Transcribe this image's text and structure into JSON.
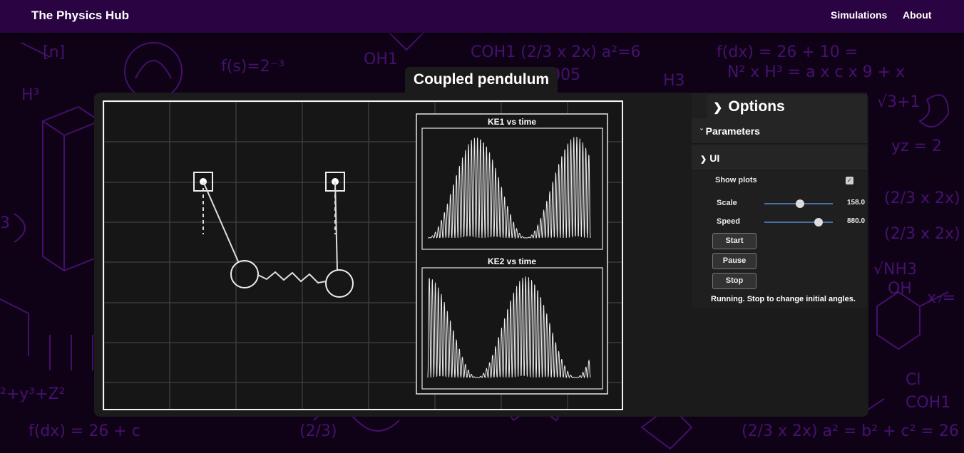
{
  "nav": {
    "brand": "The Physics Hub",
    "links": [
      "Simulations",
      "About"
    ]
  },
  "simulation": {
    "title": "Coupled pendulum",
    "plots": [
      {
        "title": "KE1 vs time"
      },
      {
        "title": "KE2 vs time"
      }
    ]
  },
  "options": {
    "title": "Options",
    "folders": {
      "parameters": "Parameters",
      "ui": "UI"
    },
    "show_plots": {
      "label": "Show plots",
      "checked": true
    },
    "scale": {
      "label": "Scale",
      "value": "158.0",
      "fraction": 0.52
    },
    "speed": {
      "label": "Speed",
      "value": "880.0",
      "fraction": 0.83
    },
    "buttons": {
      "start": "Start",
      "pause": "Pause",
      "stop": "Stop"
    },
    "status": "Running. Stop to change initial angles."
  },
  "colors": {
    "navbar": "#2a0442",
    "background": "#0f0216",
    "doodle": "#5a1a8a",
    "panel": "#1b1b1b",
    "accent": "#4a6fa5"
  },
  "icons": {
    "options_chevron": "chevron-right-icon",
    "parameters_chevron": "chevron-down-icon",
    "ui_chevron": "chevron-right-icon",
    "checkbox": "check-icon"
  }
}
